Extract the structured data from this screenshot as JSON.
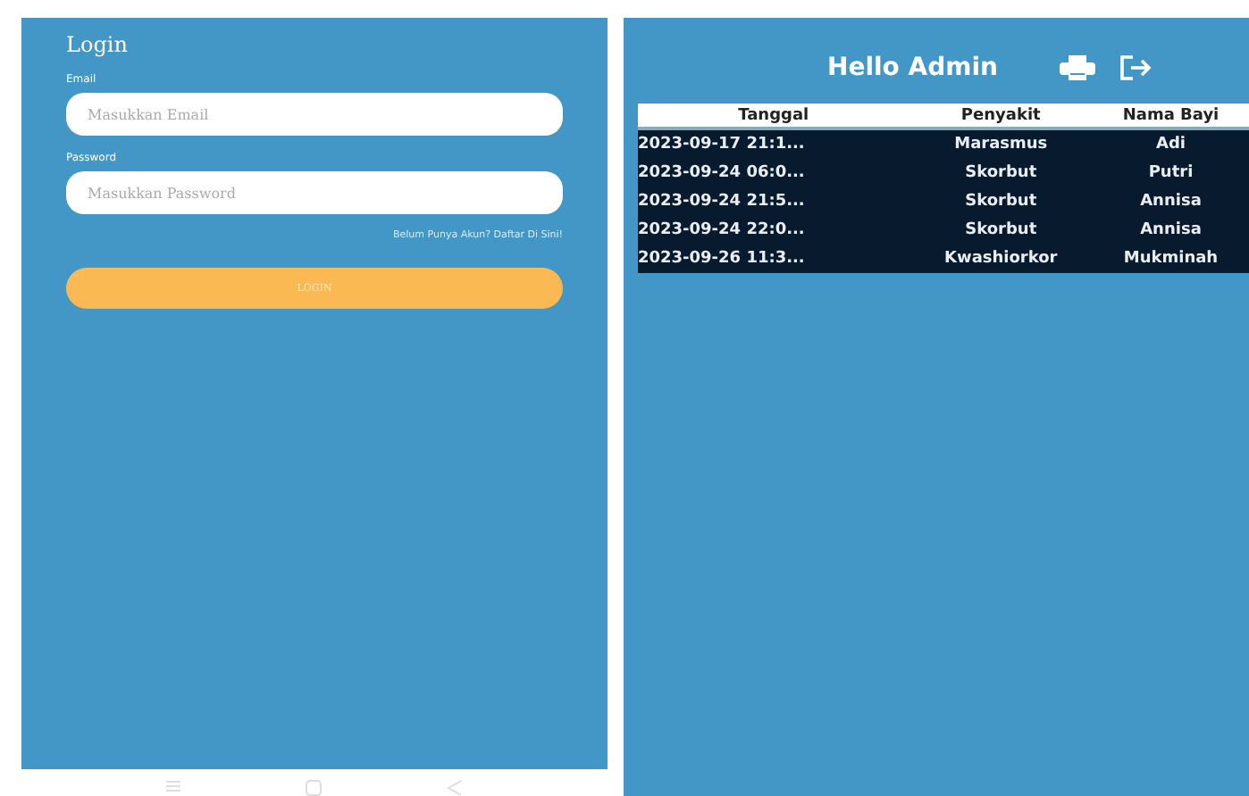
{
  "login_screen": {
    "title": "Login",
    "email_label": "Email",
    "email_placeholder": "Masukkan Email",
    "password_label": "Password",
    "password_placeholder": "Masukkan Password",
    "register_link": "Belum Punya Akun? Daftar Di Sini!",
    "login_button": "LOGIN"
  },
  "admin_screen": {
    "title": "Hello Admin",
    "table": {
      "columns": [
        "Tanggal",
        "Penyakit",
        "Nama Bayi"
      ],
      "rows": [
        [
          "2023-09-17 21:1...",
          "Marasmus",
          "Adi"
        ],
        [
          "2023-09-24 06:0...",
          "Skorbut",
          "Putri"
        ],
        [
          "2023-09-24 21:5...",
          "Skorbut",
          "Annisa"
        ],
        [
          "2023-09-24 22:0...",
          "Skorbut",
          "Annisa"
        ],
        [
          "2023-09-26 11:3...",
          "Kwashiorkor",
          "Mukminah"
        ]
      ]
    }
  }
}
